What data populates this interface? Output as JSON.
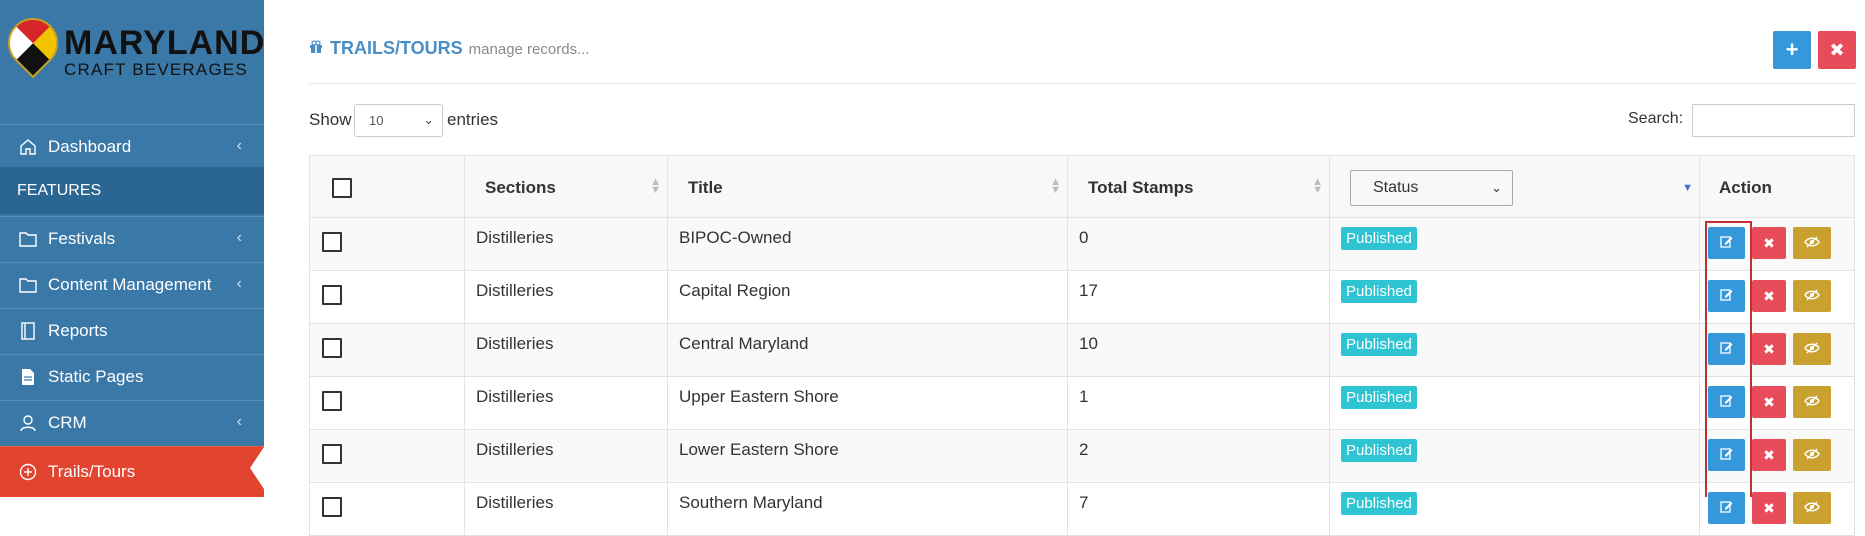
{
  "logo": {
    "line1": "MARYLAND",
    "line2": "CRAFT BEVERAGES"
  },
  "sidebar": {
    "items": [
      {
        "label": "Dashboard",
        "icon": "home-icon",
        "has_chevron": true
      },
      {
        "label": "Festivals",
        "icon": "folder-icon",
        "has_chevron": true
      },
      {
        "label": "Content Management",
        "icon": "folder-icon",
        "has_chevron": true
      },
      {
        "label": "Reports",
        "icon": "book-icon",
        "has_chevron": false
      },
      {
        "label": "Static Pages",
        "icon": "file-icon",
        "has_chevron": false
      },
      {
        "label": "CRM",
        "icon": "user-icon",
        "has_chevron": true
      },
      {
        "label": "Trails/Tours",
        "icon": "plus-circle-icon",
        "has_chevron": false,
        "active": true
      }
    ],
    "section_label": "FEATURES",
    "chevron": "‹"
  },
  "header": {
    "title": "TRAILS/TOURS",
    "subtitle": "manage records...",
    "add_label": "+",
    "close_label": "✖"
  },
  "controls": {
    "show_label": "Show",
    "page_size": "10",
    "entries_label": "entries",
    "search_label": "Search:",
    "search_value": ""
  },
  "table": {
    "columns": [
      "Sections",
      "Title",
      "Total Stamps",
      "Status",
      "Action"
    ],
    "status_filter": "Status",
    "rows": [
      {
        "section": "Distilleries",
        "title": "BIPOC-Owned",
        "stamps": "0",
        "status": "Published"
      },
      {
        "section": "Distilleries",
        "title": "Capital Region",
        "stamps": "17",
        "status": "Published"
      },
      {
        "section": "Distilleries",
        "title": "Central Maryland",
        "stamps": "10",
        "status": "Published"
      },
      {
        "section": "Distilleries",
        "title": "Upper Eastern Shore",
        "stamps": "1",
        "status": "Published"
      },
      {
        "section": "Distilleries",
        "title": "Lower Eastern Shore",
        "stamps": "2",
        "status": "Published"
      },
      {
        "section": "Distilleries",
        "title": "Southern Maryland",
        "stamps": "7",
        "status": "Published"
      }
    ]
  },
  "colors": {
    "sidebar": "#3a78a8",
    "active": "#e2442f",
    "edit": "#3498db",
    "delete": "#e84c5a",
    "view": "#c9a12e",
    "badge": "#2fc4d2",
    "title": "#4a8ec6"
  }
}
